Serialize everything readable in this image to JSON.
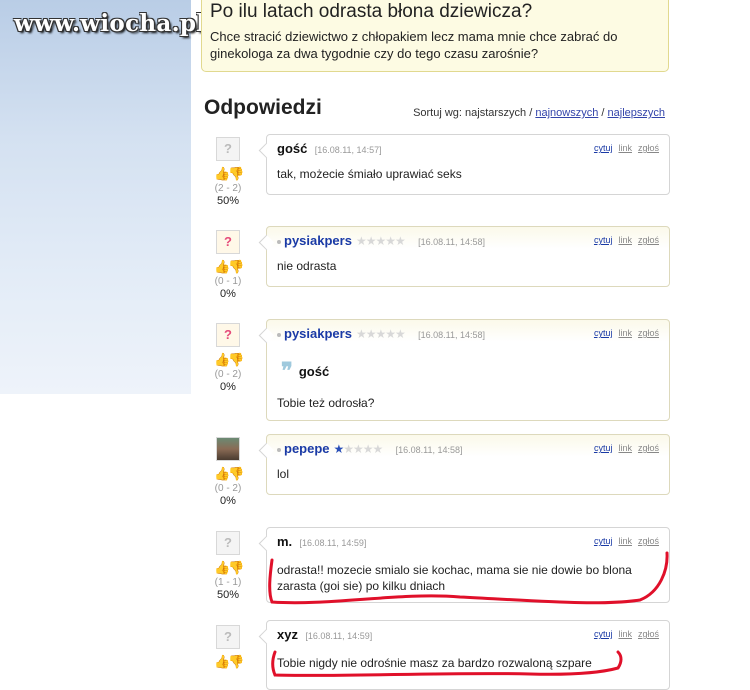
{
  "watermark": "www.wiocha.pl",
  "question": {
    "title": "Po ilu latach odrasta błona dziewicza?",
    "description": "Chce stracić dziewictwo z chłopakiem lecz mama mnie chce zabrać do ginekologa za dwa tygodnie czy do tego czasu zarośnie?"
  },
  "answers_header": "Odpowiedzi",
  "sort": {
    "label": "Sortuj wg: najstarszych /",
    "option_newest": "najnowszych",
    "separator": "/",
    "option_best": "najlepszych"
  },
  "action_labels": {
    "quote": "cytuj",
    "link": "link",
    "report": "zgłoś"
  },
  "colors": {
    "accent_link": "#1a3aa6",
    "annotation_red": "#e0102a",
    "thumb_up": "#d94c8a",
    "thumb_down": "#e0a21c"
  },
  "answers": [
    {
      "author": "gość",
      "date": "[16.08.11, 14:57]",
      "text": "tak, możecie śmiało uprawiać seks",
      "votes": "(2 - 2)",
      "percent": "50%"
    },
    {
      "author": "pysiakpers",
      "date": "[16.08.11, 14:58]",
      "text": "nie odrasta",
      "votes": "(0 - 1)",
      "percent": "0%",
      "rating": 0
    },
    {
      "author": "pysiakpers",
      "date": "[16.08.11, 14:58]",
      "quote_author": "gość",
      "text": "Tobie też odrosła?",
      "votes": "(0 - 2)",
      "percent": "0%",
      "rating": 0
    },
    {
      "author": "pepepe",
      "date": "[16.08.11, 14:58]",
      "text": "lol",
      "votes": "(0 - 2)",
      "percent": "0%",
      "rating": 0.5
    },
    {
      "author": "m.",
      "date": "[16.08.11, 14:59]",
      "text": "odrasta!! mozecie smialo sie kochac, mama sie nie dowie bo blona zarasta (goi sie) po kilku dniach",
      "votes": "(1 - 1)",
      "percent": "50%"
    },
    {
      "author": "xyz",
      "date": "[16.08.11, 14:59]",
      "text": "Tobie nigdy nie odrośnie masz za bardzo rozwaloną szpare"
    }
  ]
}
